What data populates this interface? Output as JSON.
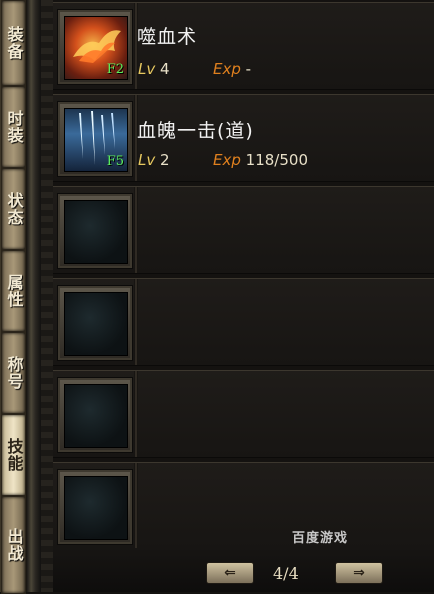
{
  "tabs": [
    {
      "label": "装备",
      "active": false
    },
    {
      "label": "时装",
      "active": false
    },
    {
      "label": "状态",
      "active": false
    },
    {
      "label": "属性",
      "active": false
    },
    {
      "label": "称号",
      "active": false
    },
    {
      "label": "技能",
      "active": true
    },
    {
      "label": "出战",
      "active": false
    }
  ],
  "skills": [
    {
      "name": "噬血术",
      "key": "F2",
      "lv_label": "Lv",
      "level": "4",
      "exp_label": "Exp",
      "exp": "-",
      "icon": "fire-skill-icon"
    },
    {
      "name": "血魄一击(道)",
      "key": "F5",
      "lv_label": "Lv",
      "level": "2",
      "exp_label": "Exp",
      "exp": "118/500",
      "icon": "ice-skill-icon"
    }
  ],
  "pager": {
    "page": "4/4",
    "prev": "⇐",
    "next": "⇒"
  },
  "watermark": "百度游戏",
  "colors": {
    "key": "#5cf05c",
    "lv": "#e6c860",
    "exp": "#e0801e",
    "name": "#f1f1f1"
  }
}
